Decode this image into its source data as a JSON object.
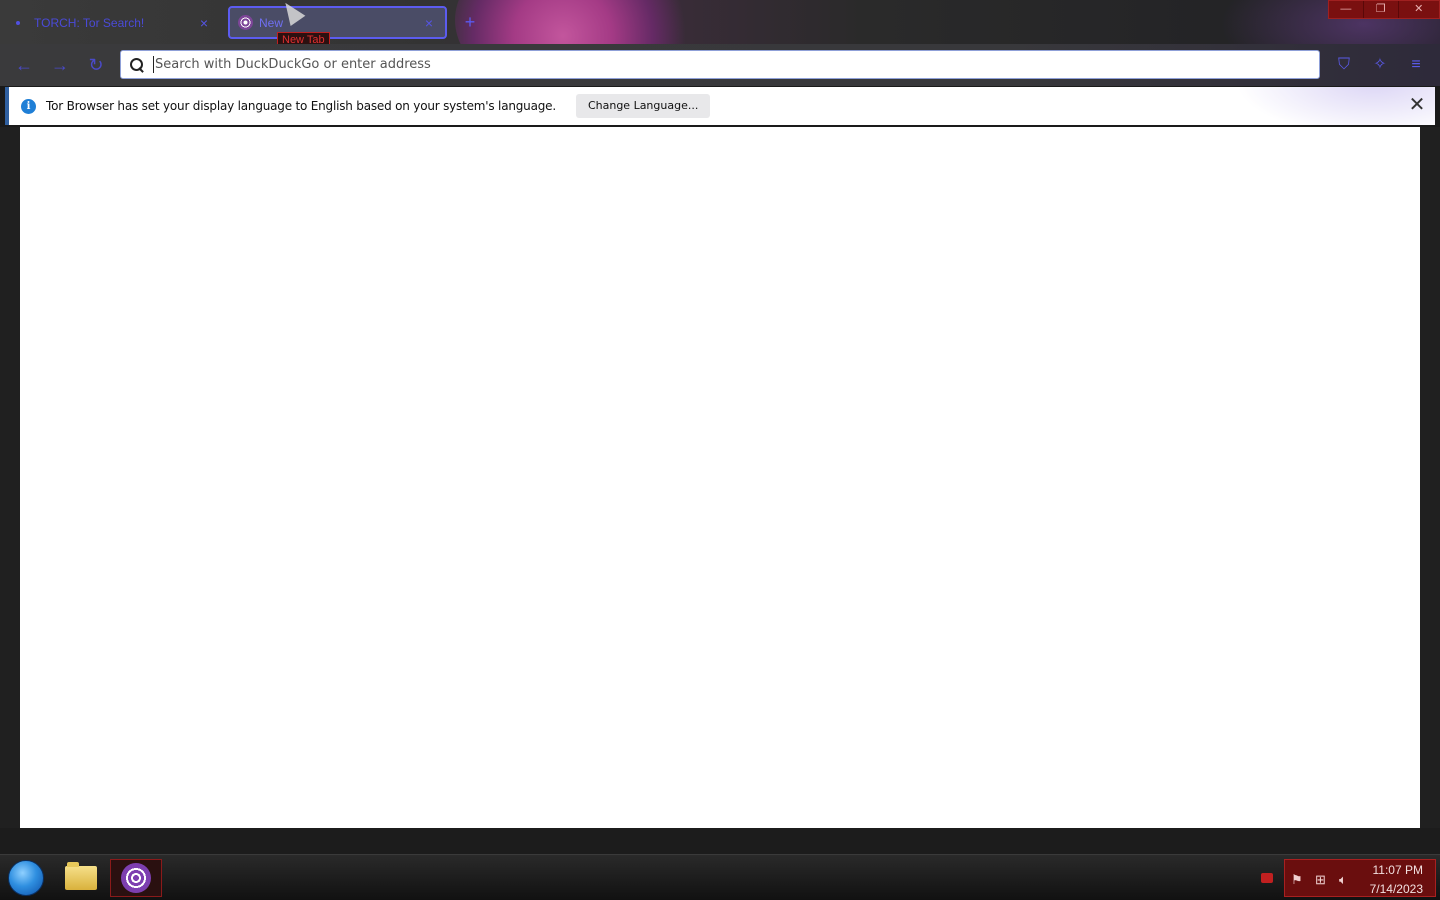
{
  "tabs": [
    {
      "label": "TORCH: Tor Search!",
      "active": false
    },
    {
      "label": "New",
      "active": true
    }
  ],
  "tooltip": "New Tab",
  "urlbar": {
    "placeholder": "Search with DuckDuckGo or enter address"
  },
  "notification": {
    "message": "Tor Browser has set your display language to English based on your system's language.",
    "button_label": "Change Language..."
  },
  "taskbar": {
    "time": "11:07 PM",
    "date": "7/14/2023"
  },
  "icons": {
    "back": "arrow-left",
    "forward": "arrow-right",
    "reload": "reload",
    "search": "magnifier",
    "shield": "shield",
    "extensions": "sparkle-broom",
    "menu": "hamburger"
  },
  "colors": {
    "accent": "#5a5af0",
    "info": "#1f7fd6",
    "tray": "#6a0e0e"
  }
}
